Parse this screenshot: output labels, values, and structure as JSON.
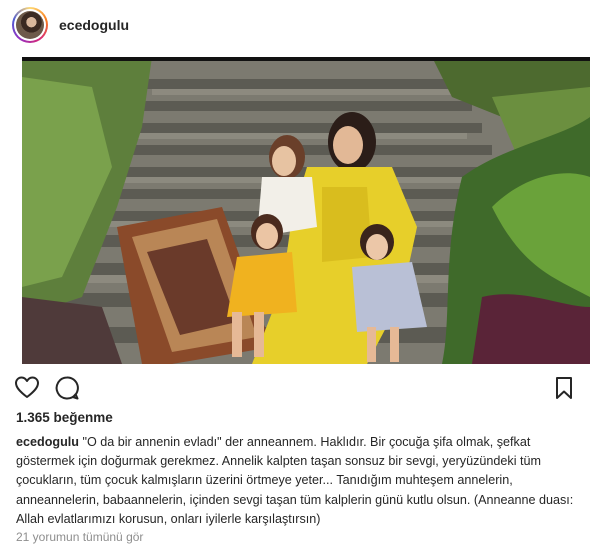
{
  "post": {
    "username": "ecedogulu",
    "likes_text": "1.365 beğenme",
    "caption": {
      "username": "ecedogulu",
      "text": "\"O da bir annenin evladı\" der anneannem. Haklıdır. Bir çocuğa şifa olmak, şefkat göstermek için doğurmak gerekmez. Annelik kalpten taşan sonsuz bir sevgi, yeryüzündeki tüm çocukların, tüm çocuk kalmışların üzerini örtmeye yeter... Tanıdığım muhteşem annelerin, anneannelerin, babaannelerin, içinden sevgi taşan tüm kalplerin günü kutlu olsun. (Anneanne duası: Allah evlatlarımızı korusun, onları iyilerle karşılaştırsın)"
    },
    "comments_link": "21 yorumun tümünü gör"
  },
  "icons": {
    "like": "heart-icon",
    "comment": "comment-icon",
    "save": "bookmark-icon"
  },
  "colors": {
    "text": "#262626",
    "muted": "#8e8e8e",
    "dress_yellow": "#e7cf2a"
  }
}
